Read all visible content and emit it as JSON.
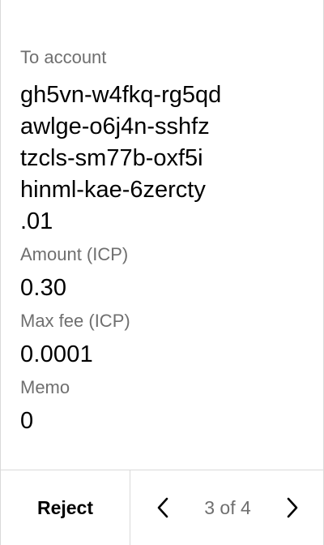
{
  "review": {
    "to_account": {
      "label": "To account",
      "lines": [
        "gh5vn-w4fkq-rg5qd",
        "awlge-o6j4n-sshfz",
        "tzcls-sm77b-oxf5i",
        "hinml-kae-6zercty",
        ".01"
      ]
    },
    "amount": {
      "label": "Amount (ICP)",
      "value": "0.30"
    },
    "max_fee": {
      "label": "Max fee (ICP)",
      "value": "0.0001"
    },
    "memo": {
      "label": "Memo",
      "value": "0"
    }
  },
  "footer": {
    "reject_label": "Reject",
    "page_indicator": "3 of 4",
    "prev_icon": "chevron-left-icon",
    "next_icon": "chevron-right-icon"
  },
  "colors": {
    "label": "#6f6f6f",
    "value": "#000000",
    "divider": "#d9d9d9",
    "background": "#ffffff"
  }
}
